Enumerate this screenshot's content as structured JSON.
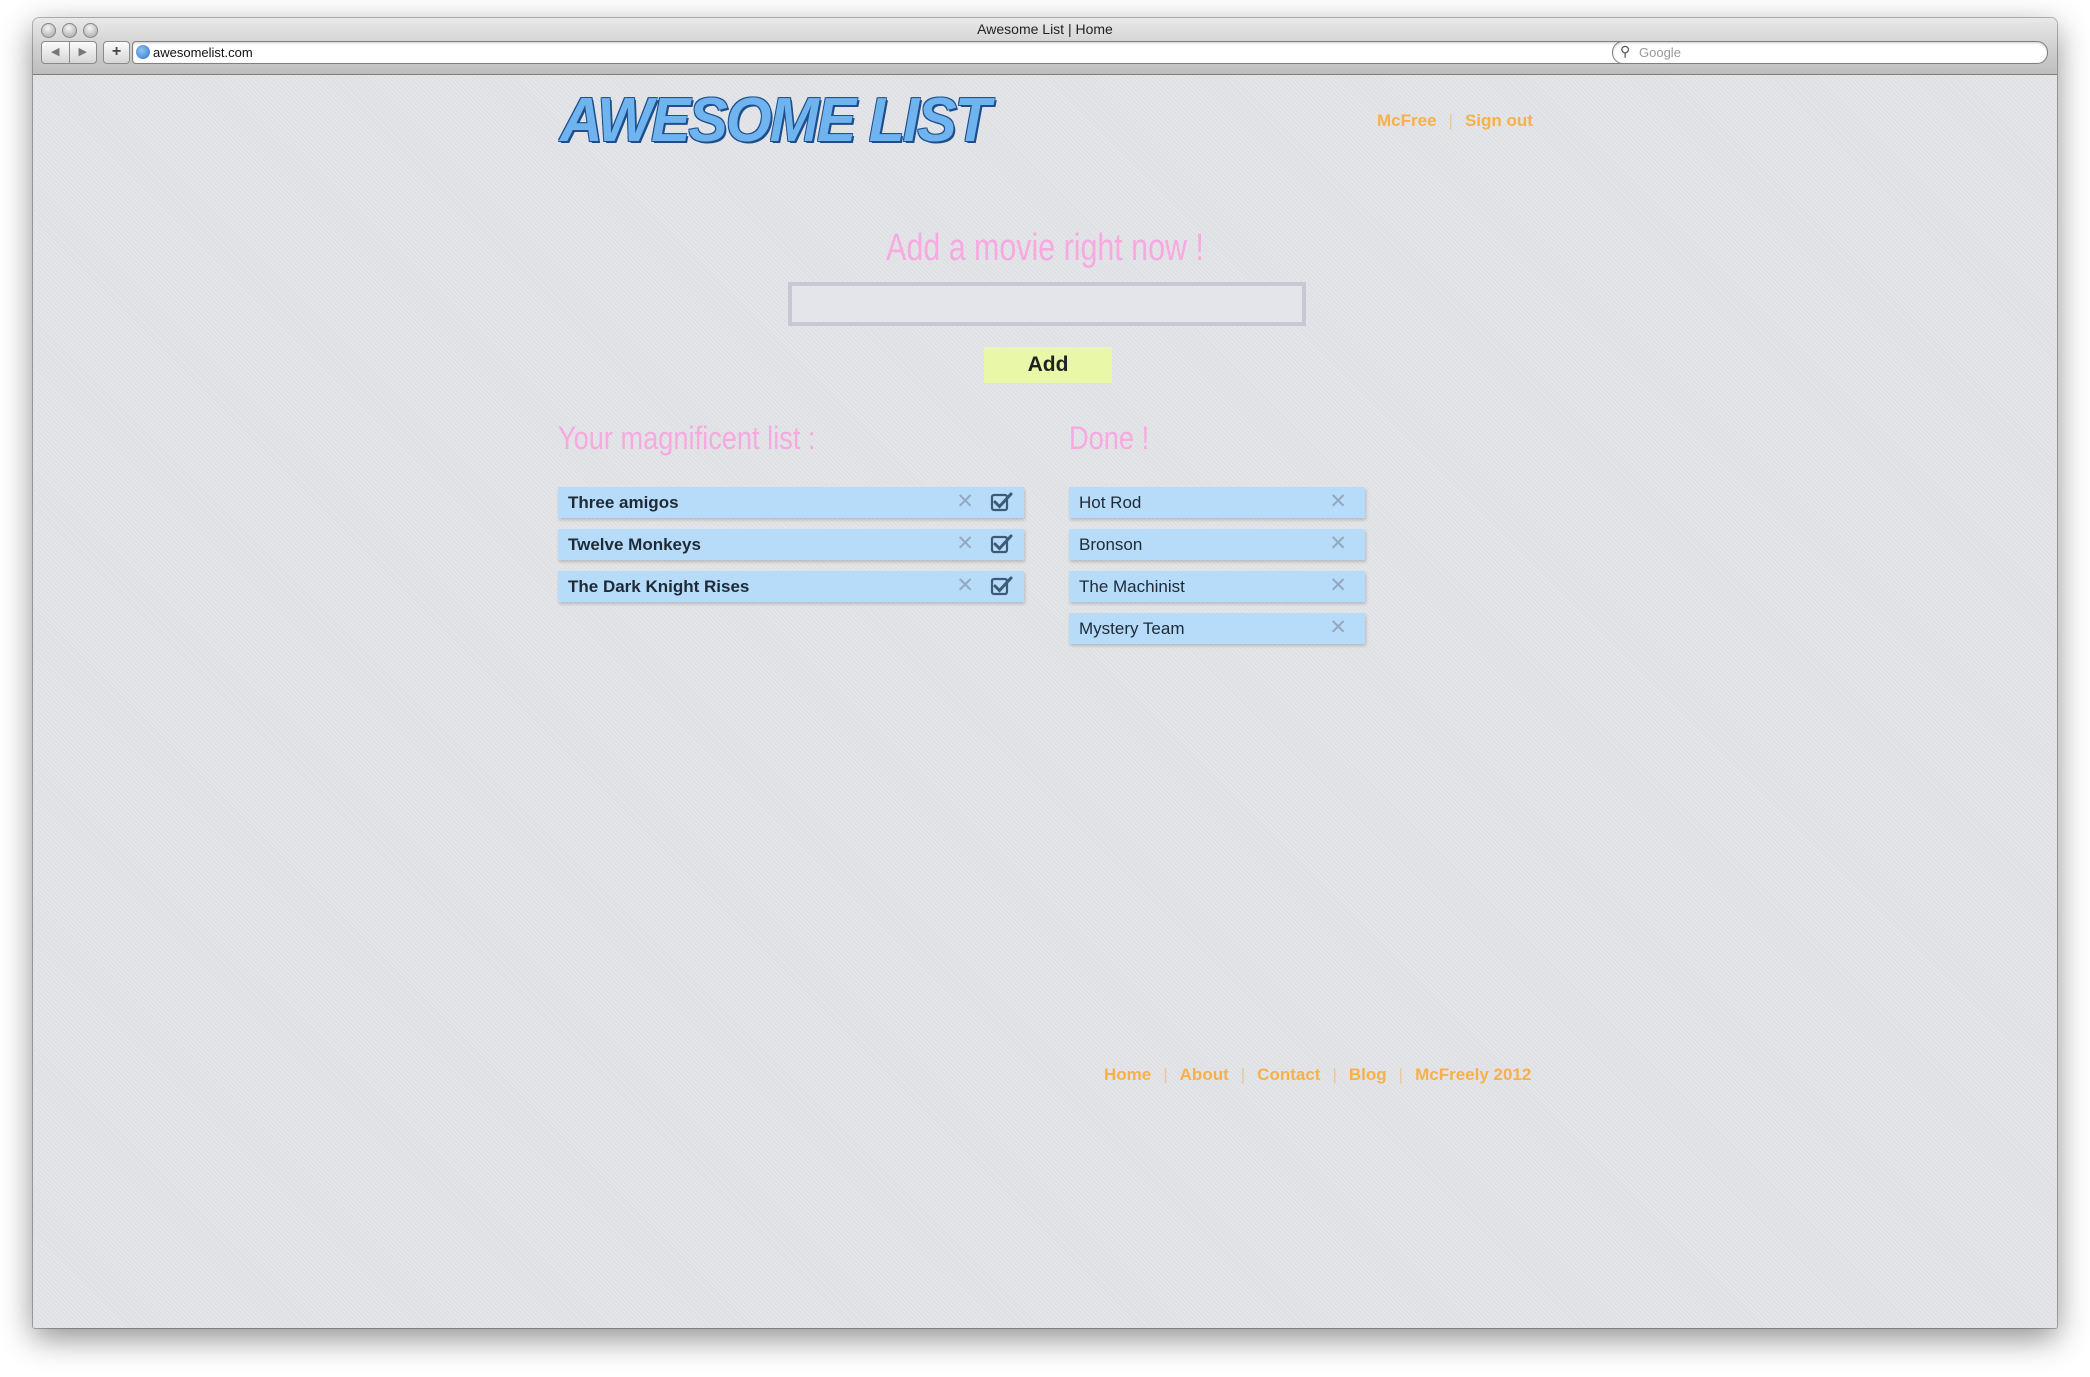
{
  "browser": {
    "window_title": "Awesome List | Home",
    "back_glyph": "◀",
    "forward_glyph": "▶",
    "new_tab_glyph": "+",
    "url": "awesomelist.com",
    "reload_glyph": "↻",
    "search_placeholder": "Google",
    "search_glyph": "⚲"
  },
  "header": {
    "logo_text": "AWESOME LIST",
    "user_link": "McFree",
    "signout_link": "Sign out",
    "separator": "|"
  },
  "add_form": {
    "heading": "Add a movie right now !",
    "input_value": "",
    "button_label": "Add"
  },
  "todo": {
    "heading": "Your magnificent list :",
    "items": [
      "Three amigos",
      "Twelve Monkeys",
      "The Dark Knight Rises"
    ]
  },
  "done": {
    "heading": "Done !",
    "items": [
      "Hot Rod",
      "Bronson",
      "The Machinist",
      "Mystery Team"
    ]
  },
  "icons": {
    "remove": "close-icon",
    "done": "checkbox-checked-icon",
    "remove_glyph": "✕"
  },
  "footer": {
    "links": [
      "Home",
      "About",
      "Contact",
      "Blog",
      "McFreely 2012"
    ],
    "separator": "|"
  },
  "colors": {
    "page_bg": "#dfe0e4",
    "accent_orange": "#f8b049",
    "heading_pink": "#f7a9e0",
    "item_blue": "#b7dcfa",
    "button_green": "#e8f8a8",
    "logo_blue": "#6fb4ee"
  }
}
